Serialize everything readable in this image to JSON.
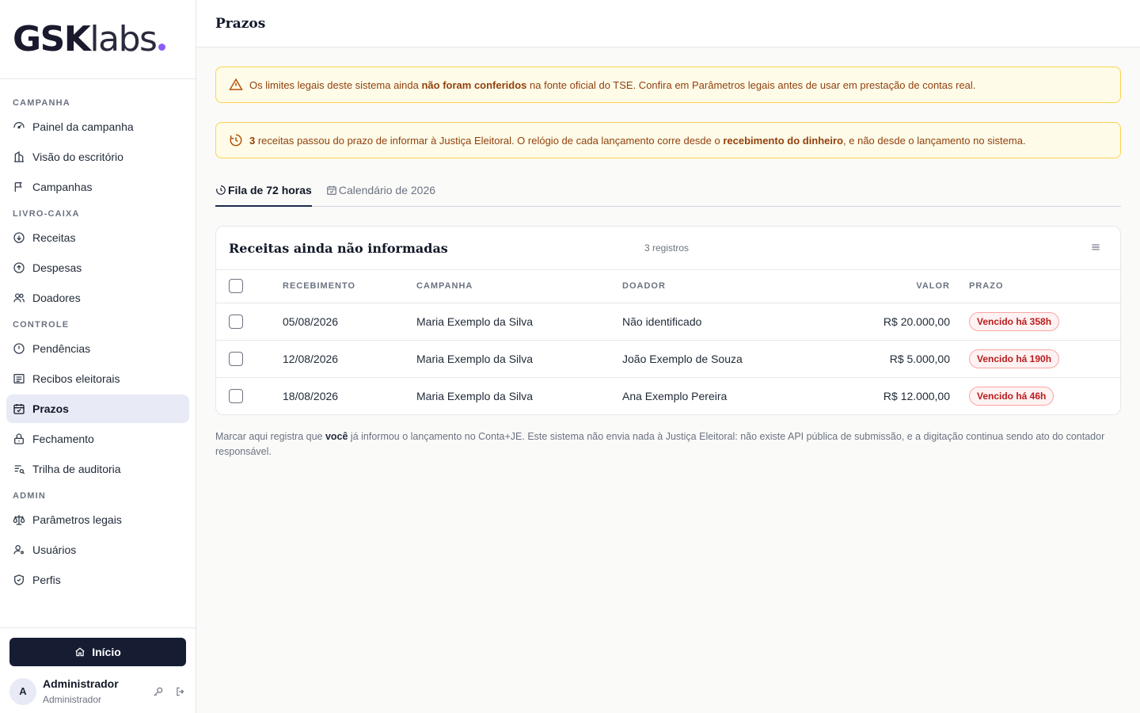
{
  "brand": {
    "bold": "GSK",
    "light": "labs"
  },
  "sidebar": {
    "sections": [
      {
        "title": "CAMPANHA",
        "items": [
          {
            "label": "Painel da campanha",
            "icon": "dashboard-icon"
          },
          {
            "label": "Visão do escritório",
            "icon": "building-icon"
          },
          {
            "label": "Campanhas",
            "icon": "flag-icon"
          }
        ]
      },
      {
        "title": "LIVRO-CAIXA",
        "items": [
          {
            "label": "Receitas",
            "icon": "arrow-down-circle-icon"
          },
          {
            "label": "Despesas",
            "icon": "arrow-up-circle-icon"
          },
          {
            "label": "Doadores",
            "icon": "users-icon"
          }
        ]
      },
      {
        "title": "CONTROLE",
        "items": [
          {
            "label": "Pendências",
            "icon": "alert-circle-icon"
          },
          {
            "label": "Recibos eleitorais",
            "icon": "receipt-icon"
          },
          {
            "label": "Prazos",
            "icon": "calendar-check-icon",
            "active": true
          },
          {
            "label": "Fechamento",
            "icon": "lock-icon"
          },
          {
            "label": "Trilha de auditoria",
            "icon": "list-search-icon"
          }
        ]
      },
      {
        "title": "ADMIN",
        "items": [
          {
            "label": "Parâmetros legais",
            "icon": "scale-icon"
          },
          {
            "label": "Usuários",
            "icon": "user-settings-icon"
          },
          {
            "label": "Perfis",
            "icon": "shield-check-icon"
          }
        ]
      }
    ],
    "home_button": "Início",
    "user": {
      "initial": "A",
      "name": "Administrador",
      "role": "Administrador"
    }
  },
  "header": {
    "title": "Prazos"
  },
  "alerts": {
    "legal": {
      "pre": "Os limites legais deste sistema ainda ",
      "bold": "não foram conferidos",
      "post": " na fonte oficial do TSE. Confira em Parâmetros legais antes de usar em prestação de contas real."
    },
    "deadline": {
      "count": "3",
      "mid": " receitas passou do prazo de informar à Justiça Eleitoral. O relógio de cada lançamento corre desde o ",
      "bold": "recebimento do dinheiro",
      "post": ", e não desde o lançamento no sistema."
    }
  },
  "tabs": [
    {
      "label": "Fila de 72 horas",
      "active": true
    },
    {
      "label": "Calendário de 2026",
      "active": false
    }
  ],
  "card": {
    "title": "Receitas ainda não informadas",
    "count": "3 registros",
    "columns": {
      "recebimento": "RECEBIMENTO",
      "campanha": "CAMPANHA",
      "doador": "DOADOR",
      "valor": "VALOR",
      "prazo": "PRAZO"
    },
    "rows": [
      {
        "recebimento": "05/08/2026",
        "campanha": "Maria Exemplo da Silva",
        "doador": "Não identificado",
        "valor": "R$ 20.000,00",
        "prazo": "Vencido há 358h"
      },
      {
        "recebimento": "12/08/2026",
        "campanha": "Maria Exemplo da Silva",
        "doador": "João Exemplo de Souza",
        "valor": "R$ 5.000,00",
        "prazo": "Vencido há 190h"
      },
      {
        "recebimento": "18/08/2026",
        "campanha": "Maria Exemplo da Silva",
        "doador": "Ana Exemplo Pereira",
        "valor": "R$ 12.000,00",
        "prazo": "Vencido há 46h"
      }
    ]
  },
  "footnote": {
    "pre": "Marcar aqui registra que ",
    "bold": "você",
    "post": " já informou o lançamento no Conta+JE. Este sistema não envia nada à Justiça Eleitoral: não existe API pública de submissão, e a digitação continua sendo ato do contador responsável."
  },
  "colors": {
    "accent": "#8b5cf6",
    "primary": "#161d33",
    "warning_bg": "#fefce8",
    "warning_text": "#92400e",
    "danger": "#b91c1c"
  }
}
